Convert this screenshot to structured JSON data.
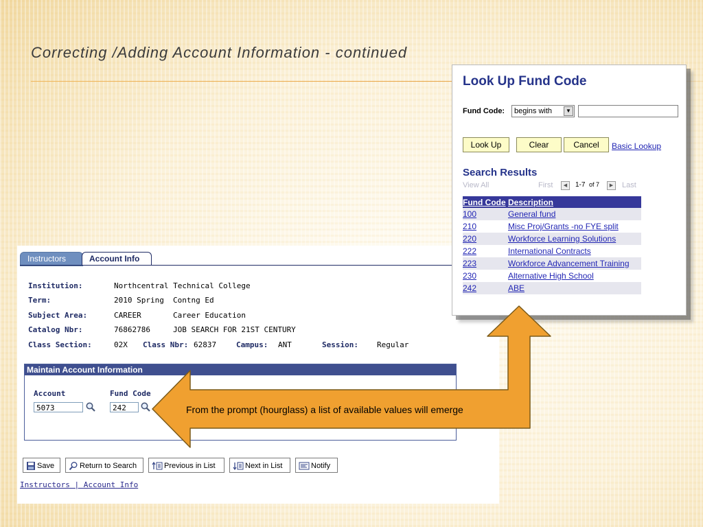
{
  "slide": {
    "title": "Correcting /Adding Account Information - continued",
    "callout_text": "From the prompt (hourglass) a list of available values will  emerge"
  },
  "tabs": [
    {
      "label": "Instructors"
    },
    {
      "label": "Account Info"
    }
  ],
  "class_info": {
    "institution_label": "Institution:",
    "institution_value": "Northcentral Technical College",
    "term_label": "Term:",
    "term_value": "2010 Spring",
    "term_desc": "Contng Ed",
    "subject_label": "Subject Area:",
    "subject_value": "CAREER",
    "subject_desc": "Career Education",
    "catalog_label": "Catalog Nbr:",
    "catalog_value": "76862786",
    "catalog_desc": "JOB SEARCH FOR 21ST CENTURY",
    "section_label": "Class Section:",
    "section_value": "02X",
    "class_nbr_label": "Class Nbr:",
    "class_nbr_value": "62837",
    "campus_label": "Campus:",
    "campus_value": "ANT",
    "session_label": "Session:",
    "session_value": "Regular"
  },
  "maintain": {
    "header": "Maintain Account Information",
    "account_label": "Account",
    "account_value": "5073",
    "fund_code_label": "Fund Code",
    "fund_code_value": "242"
  },
  "toolbar": {
    "save": "Save",
    "return_to_search": "Return to Search",
    "previous_in_list": "Previous in List",
    "next_in_list": "Next in List",
    "notify": "Notify"
  },
  "bottom_links": "Instructors | Account Info",
  "lookup": {
    "title": "Look Up Fund Code",
    "field_label": "Fund Code:",
    "operator": "begins with",
    "input_value": "",
    "lookup_button": "Look Up",
    "clear_button": "Clear",
    "cancel_button": "Cancel",
    "basic_lookup": "Basic Lookup",
    "results_title": "Search Results",
    "view_all": "View All",
    "first": "First",
    "range": "1-7",
    "of_total": "of 7",
    "last": "Last",
    "col_code": "Fund Code",
    "col_desc": "Description",
    "rows": [
      {
        "code": "100",
        "desc": "General fund"
      },
      {
        "code": "210",
        "desc": "Misc Proj/Grants -no FYE split"
      },
      {
        "code": "220",
        "desc": "Workforce Learning Solutions"
      },
      {
        "code": "222",
        "desc": "International Contracts"
      },
      {
        "code": "223",
        "desc": "Workforce Advancement Training"
      },
      {
        "code": "230",
        "desc": "Alternative High School"
      },
      {
        "code": "242",
        "desc": "ABE"
      }
    ]
  },
  "colors": {
    "arrow_fill": "#f0a030",
    "arrow_stroke": "#7a5a1a",
    "ps_header": "#3f4f8f",
    "lookup_header": "#36389a"
  }
}
